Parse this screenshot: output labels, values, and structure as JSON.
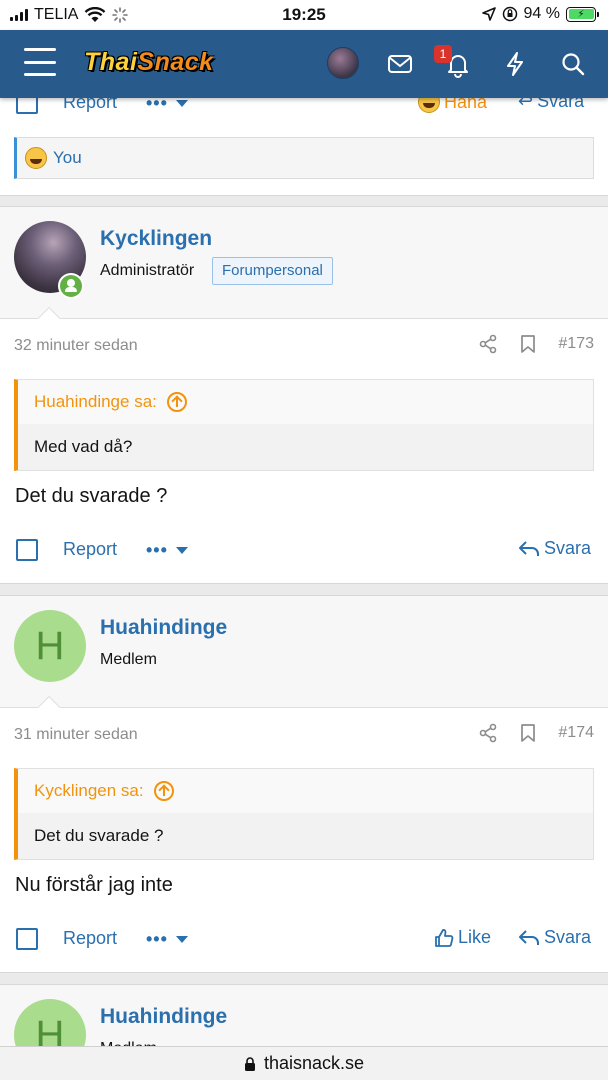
{
  "status_bar": {
    "carrier": "TELIA",
    "time": "19:25",
    "battery": "94 %"
  },
  "header": {
    "logo_part1": "Thai",
    "logo_part2": "Snack",
    "notification_count": "1"
  },
  "reaction": {
    "text": "You"
  },
  "posts": [
    {
      "username": "Kycklingen",
      "role": "Administratör",
      "staff_badge": "Forumpersonal",
      "time": "32 minuter sedan",
      "post_number": "#173",
      "quote_author": "Huahindinge sa:",
      "quote_text": "Med vad då?",
      "text": "Det du svarade ?",
      "report_label": "Report",
      "reply_label": "Svara"
    },
    {
      "username": "Huahindinge",
      "role": "Medlem",
      "avatar_letter": "H",
      "time": "31 minuter sedan",
      "post_number": "#174",
      "quote_author": "Kycklingen sa:",
      "quote_text": "Det du svarade ?",
      "text": "Nu förstår jag inte",
      "report_label": "Report",
      "like_label": "Like",
      "reply_label": "Svara"
    },
    {
      "username": "Huahindinge",
      "role": "Medlem",
      "avatar_letter": "H"
    }
  ],
  "partial_top": {
    "report_label": "Report",
    "haha_label": "Haha",
    "reply_label": "Svara"
  },
  "url_bar": {
    "domain": "thaisnack.se"
  },
  "colors": {
    "header_bg": "#285b8b",
    "link": "#2a6fae",
    "quote_accent": "#f2930d",
    "online": "#63b045"
  }
}
